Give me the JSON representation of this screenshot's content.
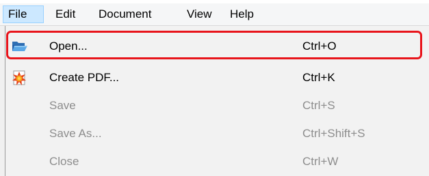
{
  "menubar": {
    "items": [
      {
        "label": "File",
        "active": true
      },
      {
        "label": "Edit"
      },
      {
        "label": "Document"
      },
      {
        "label": "View"
      },
      {
        "label": "Help"
      }
    ]
  },
  "file_menu": {
    "items": [
      {
        "label": "Open...",
        "shortcut": "Ctrl+O",
        "icon": "folder-open-icon",
        "enabled": true,
        "highlighted": true
      },
      {
        "label": "Create PDF...",
        "shortcut": "Ctrl+K",
        "icon": "create-pdf-icon",
        "enabled": true
      },
      {
        "label": "Save",
        "shortcut": "Ctrl+S",
        "enabled": false
      },
      {
        "label": "Save As...",
        "shortcut": "Ctrl+Shift+S",
        "enabled": false
      },
      {
        "label": "Close",
        "shortcut": "Ctrl+W",
        "enabled": false
      }
    ]
  },
  "colors": {
    "highlight_border": "#e8141b",
    "active_menu_bg": "#cce8ff",
    "disabled_text": "#8d8d8d"
  }
}
